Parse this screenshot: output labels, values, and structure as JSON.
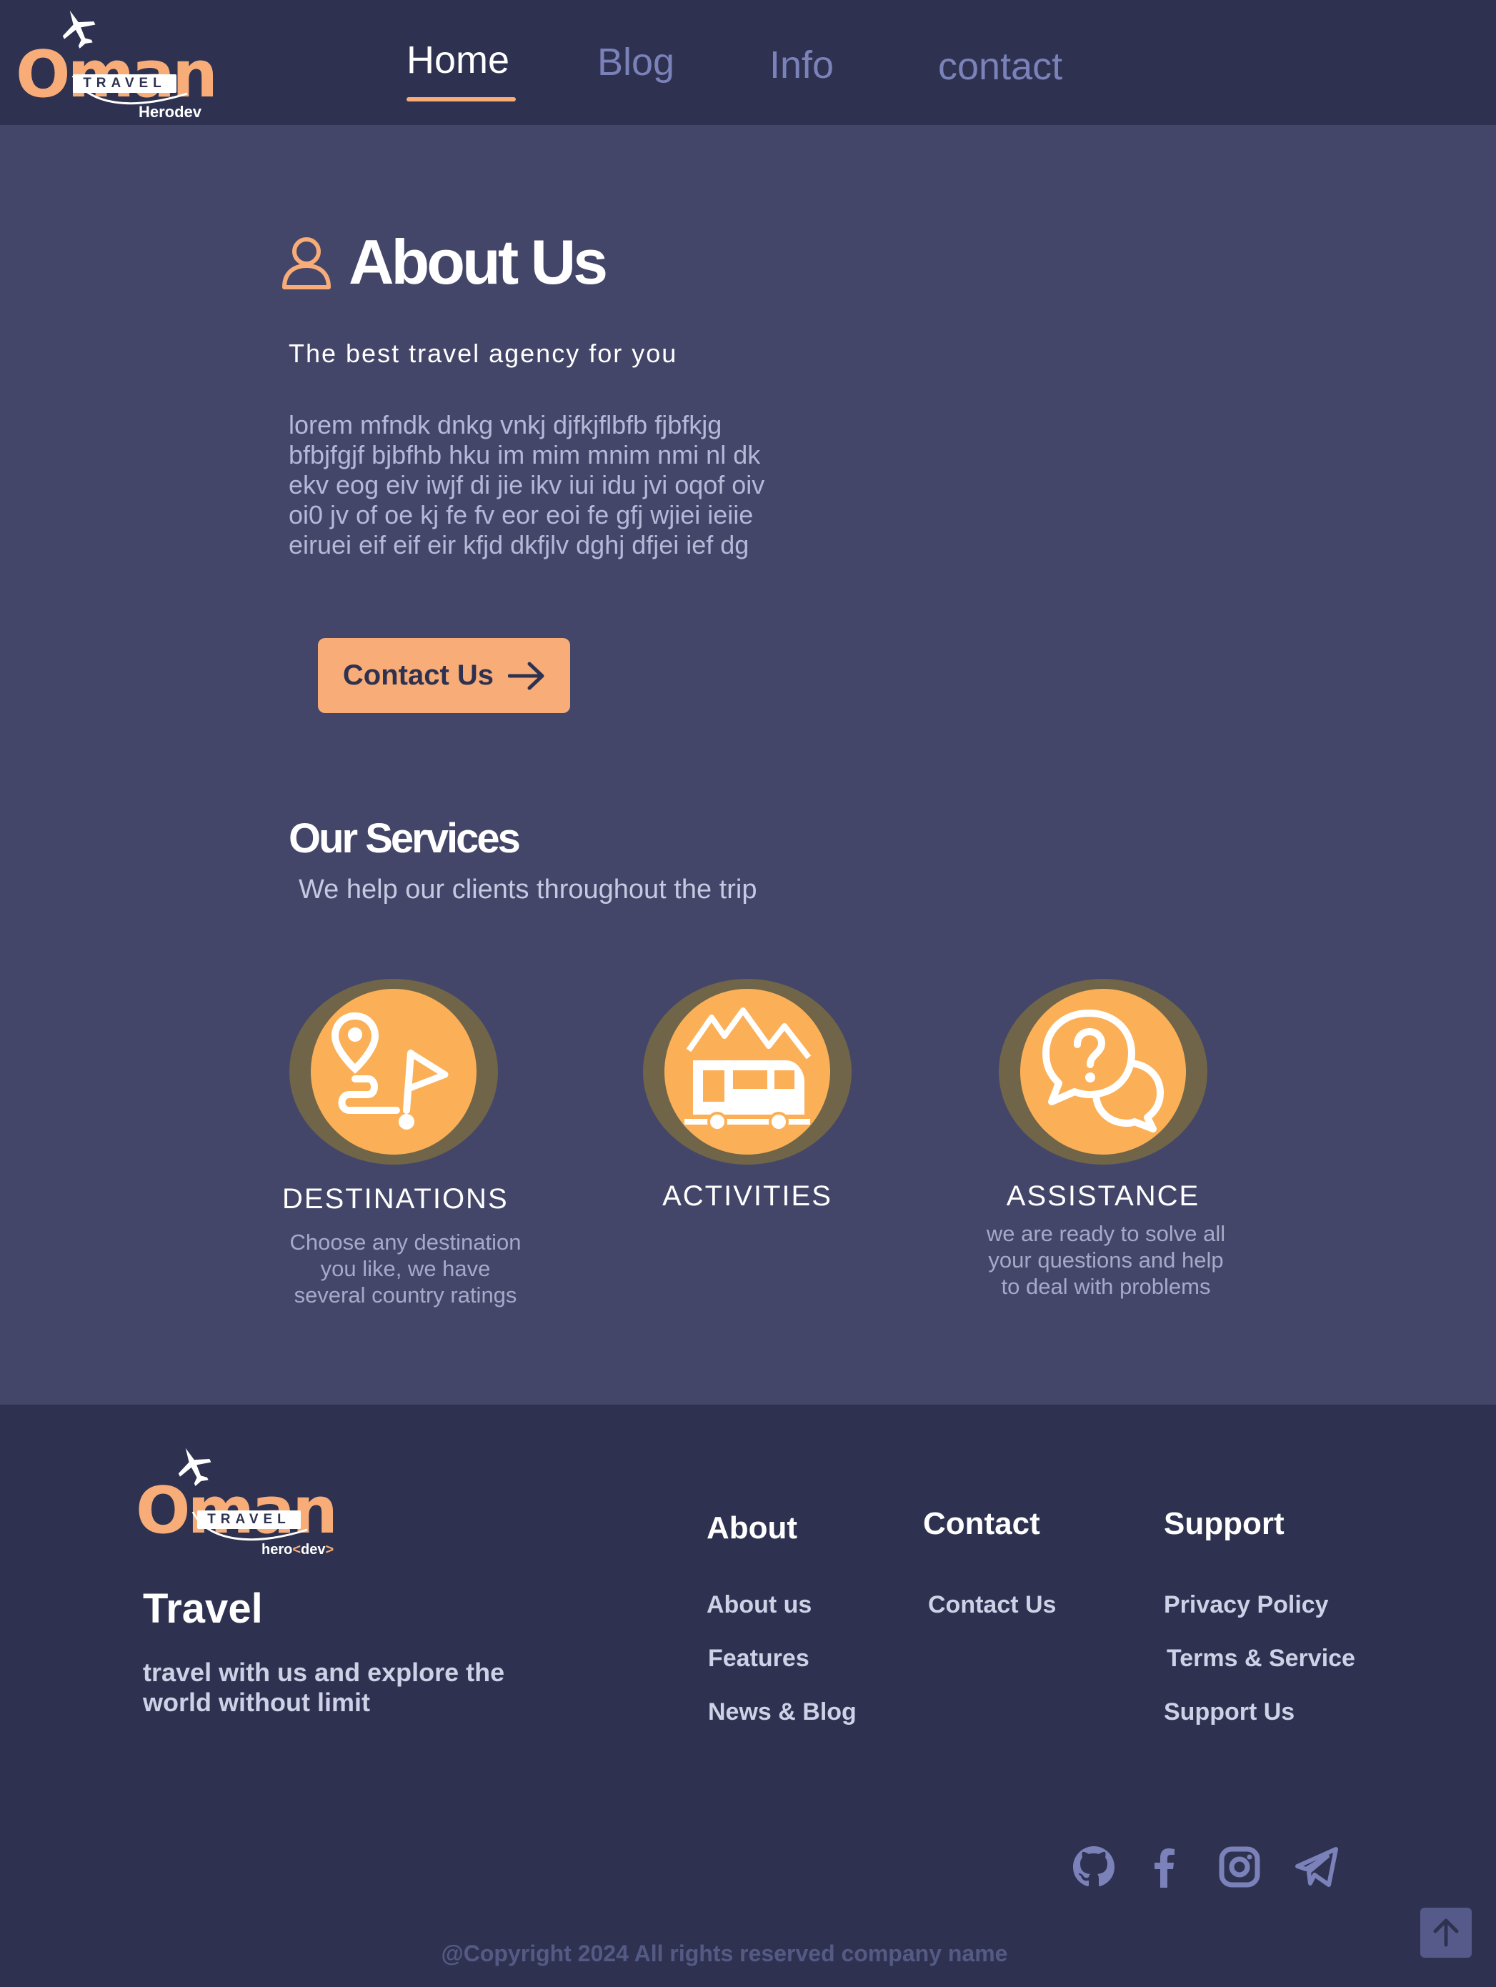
{
  "header": {
    "logo": {
      "word": "Oman",
      "badge": "TRAVEL",
      "sub": "Herodev"
    },
    "nav": [
      {
        "label": "Home",
        "active": true
      },
      {
        "label": "Blog",
        "active": false
      },
      {
        "label": "Info",
        "active": false
      },
      {
        "label": "contact",
        "active": false
      }
    ]
  },
  "about": {
    "icon": "user-icon",
    "title": "About Us",
    "tagline": "The best travel agency for you",
    "body": "lorem mfndk dnkg vnkj djfkjflbfb fjbfkjg bfbjfgjf bjbfhb hku im mim mnim nmi nl dk ekv eog eiv iwjf di jie ikv iui idu jvi oqof oiv oi0 jv of oe kj fe fv eor eoi fe gfj  wjiei ieiie eiruei eif eif eir kfjd dkfjlv dghj dfjei ief dg",
    "button": {
      "label": "Contact Us",
      "icon": "arrow-right-icon"
    }
  },
  "services": {
    "title": "Our Services",
    "subtitle": "We help our clients throughout the trip",
    "items": [
      {
        "name": "DESTINATIONS",
        "icon": "route-flag-icon",
        "desc": "Choose  any destination you like, we have several country ratings"
      },
      {
        "name": "ACTIVITIES",
        "icon": "camper-van-mountain-icon",
        "desc": ""
      },
      {
        "name": "ASSISTANCE",
        "icon": "question-chat-icon",
        "desc": "we are ready to solve all your questions and help to deal with problems"
      }
    ]
  },
  "footer": {
    "logo": {
      "word": "Oman",
      "badge": "TRAVEL",
      "sub_name": "hero",
      "sub_open": "<",
      "sub_dev": "dev",
      "sub_close": ">"
    },
    "brand": "Travel",
    "description": "travel with us and explore the world without limit",
    "columns": [
      {
        "heading": "About",
        "links": [
          "About us",
          "Features",
          "News & Blog"
        ]
      },
      {
        "heading": "Contact",
        "links": [
          "Contact Us"
        ]
      },
      {
        "heading": "Support",
        "links": [
          "Privacy Policy",
          "Terms & Service",
          "Support Us"
        ]
      }
    ],
    "social": [
      "github-icon",
      "facebook-icon",
      "instagram-icon",
      "telegram-icon"
    ],
    "copyright": "@Copyright 2024 All rights reserved company name",
    "back_to_top": "arrow-up-icon"
  },
  "colors": {
    "header_bg": "#2e3250",
    "page_bg": "#434668",
    "accent": "#f8ad78",
    "service_circle": "#fbb057",
    "service_ring": "#706548",
    "nav_inactive": "#7b82b9"
  }
}
